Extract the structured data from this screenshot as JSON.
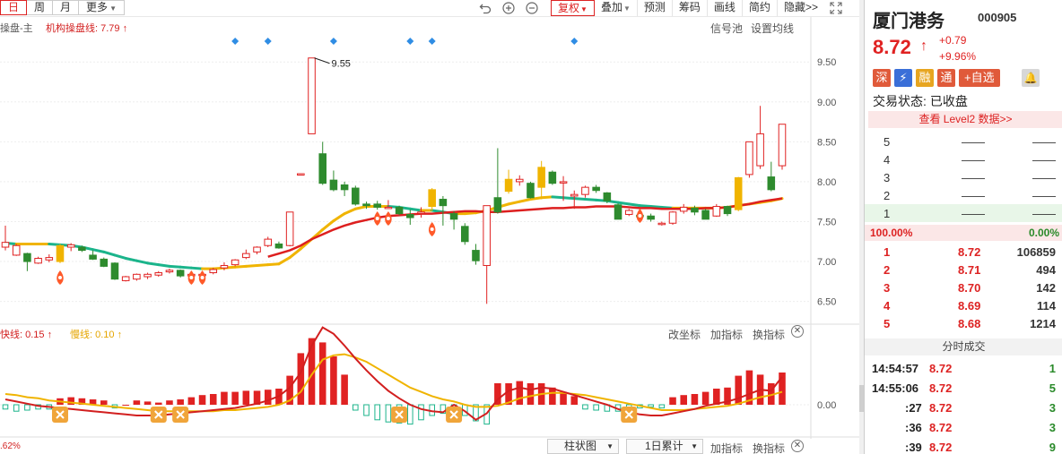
{
  "period_tabs": [
    "日",
    "周",
    "月",
    "更多"
  ],
  "toolbar": {
    "icons": [
      "undo-icon",
      "zoom-in-icon",
      "zoom-out-icon"
    ],
    "buttons": [
      "复权",
      "叠加",
      "预测",
      "筹码",
      "画线",
      "简约",
      "隐藏>>"
    ]
  },
  "main_chart": {
    "label_prefix": "操盘-主",
    "label_line": "机构操盘线: 7.79 ↑",
    "right_links": [
      "信号池",
      "设置均线"
    ],
    "peak_annotation": "9.55",
    "price_ticks": [
      "9.50",
      "9.00",
      "8.50",
      "8.00",
      "7.50",
      "7.00",
      "6.50"
    ]
  },
  "sub_chart": {
    "fast_line": "快线: 0.15 ↑",
    "slow_line": "慢线: 0.10 ↑",
    "links": [
      "改坐标",
      "加指标",
      "换指标"
    ],
    "zero_tick": "0.00",
    "bottom_left": ".62%"
  },
  "bottom_bar": {
    "type_select": "柱状图",
    "accum_select": "1日累计",
    "links": [
      "加指标",
      "换指标"
    ]
  },
  "chart_data": {
    "type": "candlestick",
    "ylim": [
      6.35,
      9.85
    ],
    "candles": [
      [
        7.18,
        7.24,
        7.45,
        7.14
      ],
      [
        7.08,
        7.2,
        7.22,
        7.07
      ],
      [
        7.1,
        7.0,
        7.11,
        6.88
      ],
      [
        6.98,
        7.04,
        7.06,
        6.97
      ],
      [
        7.02,
        7.05,
        7.09,
        6.99
      ],
      [
        7.2,
        7.0,
        7.22,
        6.98
      ],
      [
        7.18,
        7.21,
        7.23,
        7.13
      ],
      [
        7.18,
        7.14,
        7.2,
        7.12
      ],
      [
        7.08,
        7.03,
        7.14,
        7.02
      ],
      [
        7.03,
        6.94,
        7.05,
        6.93
      ],
      [
        6.98,
        6.78,
        6.99,
        6.77
      ],
      [
        6.76,
        6.81,
        6.82,
        6.75
      ],
      [
        6.78,
        6.84,
        6.85,
        6.76
      ],
      [
        6.81,
        6.84,
        6.86,
        6.78
      ],
      [
        6.83,
        6.86,
        6.88,
        6.81
      ],
      [
        6.87,
        6.89,
        6.91,
        6.85
      ],
      [
        6.89,
        6.82,
        6.9,
        6.8
      ],
      [
        6.82,
        6.84,
        6.86,
        6.78
      ],
      [
        6.84,
        6.84,
        6.85,
        6.8
      ],
      [
        6.86,
        6.9,
        6.92,
        6.84
      ],
      [
        6.92,
        6.95,
        6.99,
        6.89
      ],
      [
        6.96,
        7.02,
        7.03,
        6.94
      ],
      [
        7.05,
        7.1,
        7.15,
        7.03
      ],
      [
        7.12,
        7.18,
        7.19,
        7.09
      ],
      [
        7.2,
        7.28,
        7.31,
        7.18
      ],
      [
        7.22,
        7.17,
        7.25,
        7.16
      ],
      [
        7.2,
        7.62,
        7.62,
        7.19
      ],
      [
        8.1,
        8.1,
        8.1,
        8.1
      ],
      [
        8.6,
        9.55,
        9.55,
        8.6
      ],
      [
        8.35,
        7.98,
        8.5,
        7.96
      ],
      [
        8.02,
        7.9,
        8.14,
        7.88
      ],
      [
        7.96,
        7.9,
        8.0,
        7.82
      ],
      [
        7.92,
        7.72,
        7.95,
        7.7
      ],
      [
        7.72,
        7.7,
        7.75,
        7.66
      ],
      [
        7.72,
        7.68,
        7.76,
        7.65
      ],
      [
        7.67,
        7.68,
        7.77,
        7.67
      ],
      [
        7.68,
        7.6,
        7.7,
        7.58
      ],
      [
        7.59,
        7.55,
        7.65,
        7.46
      ],
      [
        7.61,
        7.62,
        7.68,
        7.55
      ],
      [
        7.69,
        7.9,
        7.92,
        7.63
      ],
      [
        7.78,
        7.7,
        7.82,
        7.45
      ],
      [
        7.6,
        7.53,
        7.63,
        7.4
      ],
      [
        7.44,
        7.25,
        7.48,
        7.21
      ],
      [
        7.14,
        7.01,
        7.22,
        6.96
      ],
      [
        6.95,
        7.7,
        7.7,
        6.47
      ],
      [
        7.8,
        7.62,
        8.42,
        7.6
      ],
      [
        7.88,
        8.03,
        8.15,
        7.85
      ],
      [
        8.0,
        8.03,
        8.08,
        7.95
      ],
      [
        7.98,
        7.8,
        8.0,
        7.79
      ],
      [
        7.93,
        8.18,
        8.26,
        7.78
      ],
      [
        8.12,
        7.98,
        8.14,
        7.96
      ],
      [
        7.99,
        8.0,
        8.07,
        7.76
      ],
      [
        7.82,
        7.84,
        7.89,
        7.66
      ],
      [
        7.84,
        7.93,
        7.95,
        7.8
      ],
      [
        7.93,
        7.89,
        7.96,
        7.86
      ],
      [
        7.86,
        7.76,
        7.87,
        7.73
      ],
      [
        7.71,
        7.53,
        7.73,
        7.53
      ],
      [
        7.59,
        7.64,
        7.66,
        7.57
      ],
      [
        7.58,
        7.56,
        7.6,
        7.52
      ],
      [
        7.57,
        7.53,
        7.6,
        7.5
      ],
      [
        7.48,
        7.48,
        7.5,
        7.45
      ],
      [
        7.48,
        7.62,
        7.63,
        7.46
      ],
      [
        7.63,
        7.68,
        7.72,
        7.6
      ],
      [
        7.67,
        7.62,
        7.7,
        7.58
      ],
      [
        7.64,
        7.53,
        7.66,
        7.53
      ],
      [
        7.57,
        7.69,
        7.72,
        7.56
      ],
      [
        7.69,
        7.6,
        7.7,
        7.57
      ],
      [
        7.65,
        8.05,
        8.06,
        7.63
      ],
      [
        8.09,
        8.5,
        8.5,
        8.05
      ],
      [
        8.2,
        8.6,
        8.95,
        8.16
      ],
      [
        8.06,
        7.9,
        8.25,
        7.88
      ],
      [
        8.2,
        8.72,
        8.72,
        8.15
      ]
    ],
    "signal_line": [
      7.23,
      7.22,
      7.22,
      7.22,
      7.22,
      7.21,
      7.2,
      7.18,
      7.15,
      7.12,
      7.08,
      7.04,
      7.01,
      6.98,
      6.96,
      6.94,
      6.93,
      6.92,
      6.91,
      6.91,
      6.92,
      6.93,
      6.94,
      6.95,
      6.96,
      6.97,
      7.05,
      7.16,
      7.28,
      7.4,
      7.51,
      7.6,
      7.66,
      7.69,
      7.69,
      7.69,
      7.68,
      7.66,
      7.64,
      7.64,
      7.62,
      7.6,
      7.6,
      7.61,
      7.64,
      7.68,
      7.72,
      7.75,
      7.78,
      7.8,
      7.81,
      7.8,
      7.79,
      7.78,
      7.77,
      7.76,
      7.74,
      7.72,
      7.7,
      7.69,
      7.68,
      7.67,
      7.67,
      7.67,
      7.67,
      7.67,
      7.68,
      7.7,
      7.72,
      7.74,
      7.76,
      7.79
    ],
    "main_line": [
      null,
      null,
      null,
      null,
      null,
      null,
      null,
      null,
      null,
      null,
      null,
      null,
      null,
      null,
      null,
      null,
      null,
      null,
      null,
      null,
      null,
      null,
      null,
      null,
      7.06,
      7.1,
      7.14,
      7.2,
      7.28,
      7.34,
      7.4,
      7.45,
      7.49,
      7.52,
      7.55,
      7.57,
      7.58,
      7.59,
      7.6,
      7.6,
      7.61,
      7.62,
      7.63,
      7.63,
      7.62,
      7.62,
      7.63,
      7.64,
      7.65,
      7.66,
      7.67,
      7.67,
      7.68,
      7.68,
      7.69,
      7.69,
      7.69,
      7.68,
      7.67,
      7.67,
      7.66,
      7.66,
      7.66,
      7.66,
      7.67,
      7.67,
      7.68,
      7.7,
      7.72,
      7.75,
      7.77,
      7.79
    ],
    "macd_hist": [
      -0.04,
      -0.06,
      -0.05,
      -0.04,
      -0.04,
      0.06,
      0.07,
      0.06,
      0.05,
      0.04,
      -0.03,
      0.0,
      0.04,
      0.03,
      0.02,
      0.04,
      0.05,
      0.07,
      0.09,
      0.1,
      0.12,
      0.12,
      0.13,
      0.13,
      0.14,
      0.15,
      0.27,
      0.48,
      0.62,
      0.58,
      0.45,
      0.28,
      -0.05,
      -0.1,
      -0.14,
      -0.16,
      -0.17,
      -0.18,
      -0.14,
      -0.1,
      -0.08,
      -0.05,
      -0.1,
      -0.15,
      -0.18,
      0.2,
      0.2,
      0.22,
      0.2,
      0.2,
      0.16,
      0.12,
      0.08,
      -0.04,
      -0.05,
      -0.06,
      -0.06,
      -0.04,
      -0.03,
      -0.02,
      -0.03,
      0.07,
      0.09,
      0.1,
      0.12,
      0.15,
      0.16,
      0.27,
      0.32,
      0.28,
      0.2,
      0.3
    ],
    "macd_fast": [
      0.05,
      0.03,
      0.01,
      -0.01,
      -0.02,
      -0.03,
      -0.04,
      -0.05,
      -0.06,
      -0.07,
      -0.08,
      -0.09,
      -0.1,
      -0.1,
      -0.1,
      -0.09,
      -0.08,
      -0.07,
      -0.06,
      -0.05,
      -0.04,
      -0.03,
      -0.01,
      0.01,
      0.04,
      0.08,
      0.16,
      0.3,
      0.55,
      0.72,
      0.66,
      0.55,
      0.43,
      0.32,
      0.22,
      0.13,
      0.06,
      0.0,
      -0.04,
      -0.06,
      -0.07,
      0.0,
      -0.06,
      -0.14,
      -0.08,
      0.05,
      0.13,
      0.16,
      0.14,
      0.16,
      0.15,
      0.12,
      0.09,
      0.06,
      0.03,
      0.0,
      -0.04,
      -0.07,
      -0.09,
      -0.1,
      -0.1,
      -0.08,
      -0.06,
      -0.04,
      -0.01,
      0.01,
      0.03,
      0.06,
      0.1,
      0.14,
      0.13,
      0.26
    ],
    "macd_slow": [
      0.1,
      0.09,
      0.07,
      0.06,
      0.04,
      0.03,
      0.02,
      0.01,
      0.0,
      -0.01,
      -0.02,
      -0.03,
      -0.04,
      -0.05,
      -0.06,
      -0.06,
      -0.06,
      -0.06,
      -0.06,
      -0.06,
      -0.05,
      -0.05,
      -0.04,
      -0.03,
      -0.02,
      0.0,
      0.04,
      0.12,
      0.28,
      0.42,
      0.46,
      0.47,
      0.44,
      0.4,
      0.34,
      0.28,
      0.22,
      0.16,
      0.12,
      0.08,
      0.05,
      0.03,
      0.0,
      -0.02,
      -0.02,
      -0.01,
      0.02,
      0.06,
      0.08,
      0.1,
      0.11,
      0.11,
      0.1,
      0.09,
      0.07,
      0.05,
      0.03,
      0.01,
      -0.01,
      -0.03,
      -0.05,
      -0.05,
      -0.05,
      -0.04,
      -0.03,
      -0.02,
      -0.01,
      0.01,
      0.04,
      0.07,
      0.09,
      0.12
    ],
    "cross_markers_at": [
      7,
      24,
      25,
      57,
      65,
      92
    ],
    "diamonds_at": [
      38,
      42,
      54,
      66,
      69,
      93
    ],
    "rockets_at": [
      9,
      30,
      31,
      61,
      70,
      103
    ]
  },
  "panel": {
    "name": "厦门港务",
    "code": "000905",
    "price": "8.72",
    "price_arrow": "↑",
    "change": "+0.79",
    "change_pct": "+9.96%",
    "badges": [
      "深",
      "⚡",
      "融",
      "通",
      "+自选"
    ],
    "badge_colors": [
      "#e05a3a",
      "#3a6fd8",
      "#e7a520",
      "#e05a3a",
      "#e05a3a"
    ],
    "status_label": "交易状态:",
    "status_value": "已收盘",
    "level2": "查看 Level2 数据>>",
    "ask": [
      {
        "level": "5",
        "price": "——",
        "vol": "——"
      },
      {
        "level": "4",
        "price": "——",
        "vol": "——"
      },
      {
        "level": "3",
        "price": "——",
        "vol": "——"
      },
      {
        "level": "2",
        "price": "——",
        "vol": "——"
      },
      {
        "level": "1",
        "price": "——",
        "vol": "——"
      }
    ],
    "ratio_left": "100.00%",
    "ratio_right": "0.00%",
    "bid": [
      {
        "level": "1",
        "price": "8.72",
        "vol": "106859"
      },
      {
        "level": "2",
        "price": "8.71",
        "vol": "494"
      },
      {
        "level": "3",
        "price": "8.70",
        "vol": "142"
      },
      {
        "level": "4",
        "price": "8.69",
        "vol": "114"
      },
      {
        "level": "5",
        "price": "8.68",
        "vol": "1214"
      }
    ],
    "trades_title": "分时成交",
    "trades": [
      {
        "time": "14:54:57",
        "price": "8.72",
        "vol": "1"
      },
      {
        "time": "14:55:06",
        "price": "8.72",
        "vol": "5"
      },
      {
        "time": ":27",
        "price": "8.72",
        "vol": "3"
      },
      {
        "time": ":36",
        "price": "8.72",
        "vol": "3"
      },
      {
        "time": ":39",
        "price": "8.72",
        "vol": "9"
      }
    ]
  },
  "colors": {
    "up": "#e02222",
    "down": "#2e8b2e",
    "accent": "#d22",
    "yellow": "#f0b400",
    "teal": "#1bb48b",
    "signal_red": "#dd1f1f"
  }
}
